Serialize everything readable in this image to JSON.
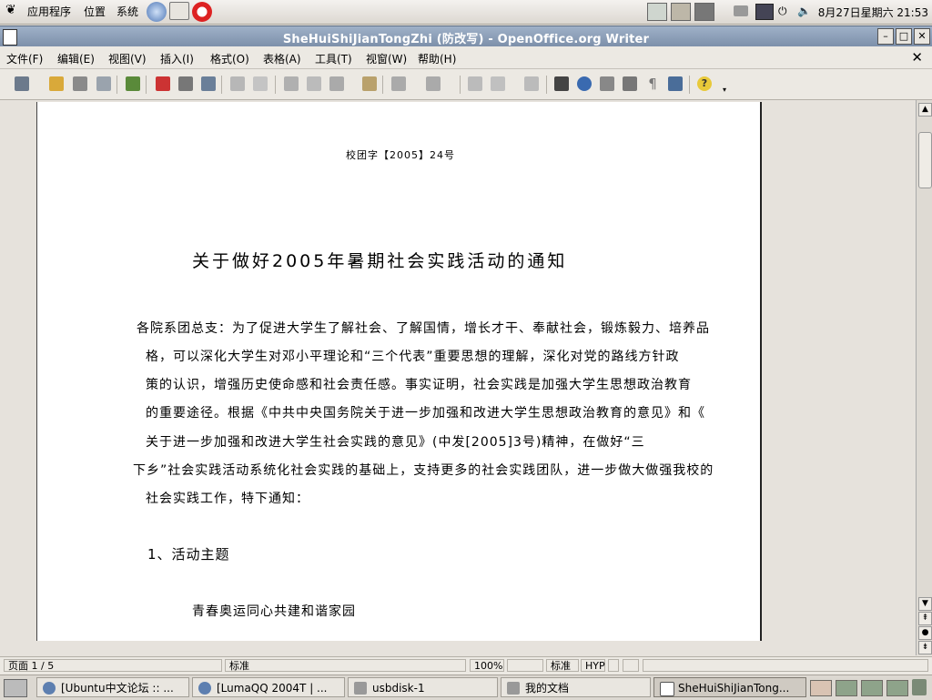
{
  "top_panel": {
    "menus": [
      "应用程序",
      "位置",
      "系统"
    ],
    "clock": "8月27日星期六 21:53"
  },
  "window": {
    "title": "SheHuiShiJianTongZhi (防改写) - OpenOffice.org Writer"
  },
  "menubar": {
    "items": [
      "文件(F)",
      "编辑(E)",
      "视图(V)",
      "插入(I)",
      "格式(O)",
      "表格(A)",
      "工具(T)",
      "视窗(W)",
      "帮助(H)"
    ],
    "close": "✕"
  },
  "document": {
    "doc_number": "校团字【2005】24号",
    "heading": "关于做好2005年暑期社会实践活动的通知",
    "lines": [
      "    各院系团总支：为了促进大学生了解社会、了解国情，增长才干、奉献社会，锻炼毅力、培养品",
      "格，可以深化大学生对邓小平理论和“三个代表”重要思想的理解，深化对党的路线方针政",
      "策的认识，增强历史使命感和社会责任感。事实证明，社会实践是加强大学生思想政治教育",
      "的重要途径。根据《中共中央国务院关于进一步加强和改进大学生思想政治教育的意见》和《",
      "关于进一步加强和改进大学生社会实践的意见》(中发[2005]3号)精神，在做好“三",
      "下乡”社会实践活动系统化社会实践的基础上，支持更多的社会实践团队，进一步做大做强我校的",
      "社会实践工作，特下通知："
    ],
    "section1": "1、活动主题",
    "subline": "青春奥运同心共建和谐家园"
  },
  "statusbar": {
    "page": "页面 1 / 5",
    "style": "标准",
    "zoom": "100%",
    "mode": "标准",
    "hyp": "HYP"
  },
  "taskbar": {
    "tasks": [
      "[Ubuntu中文论坛 :: ...",
      "[LumaQQ 2004T | ...",
      "usbdisk-1",
      "我的文档",
      "SheHuiShiJianTong..."
    ]
  },
  "colors": {
    "titlebar": "#8799b3",
    "panel": "#dcd8d1",
    "page": "#ffffff"
  }
}
